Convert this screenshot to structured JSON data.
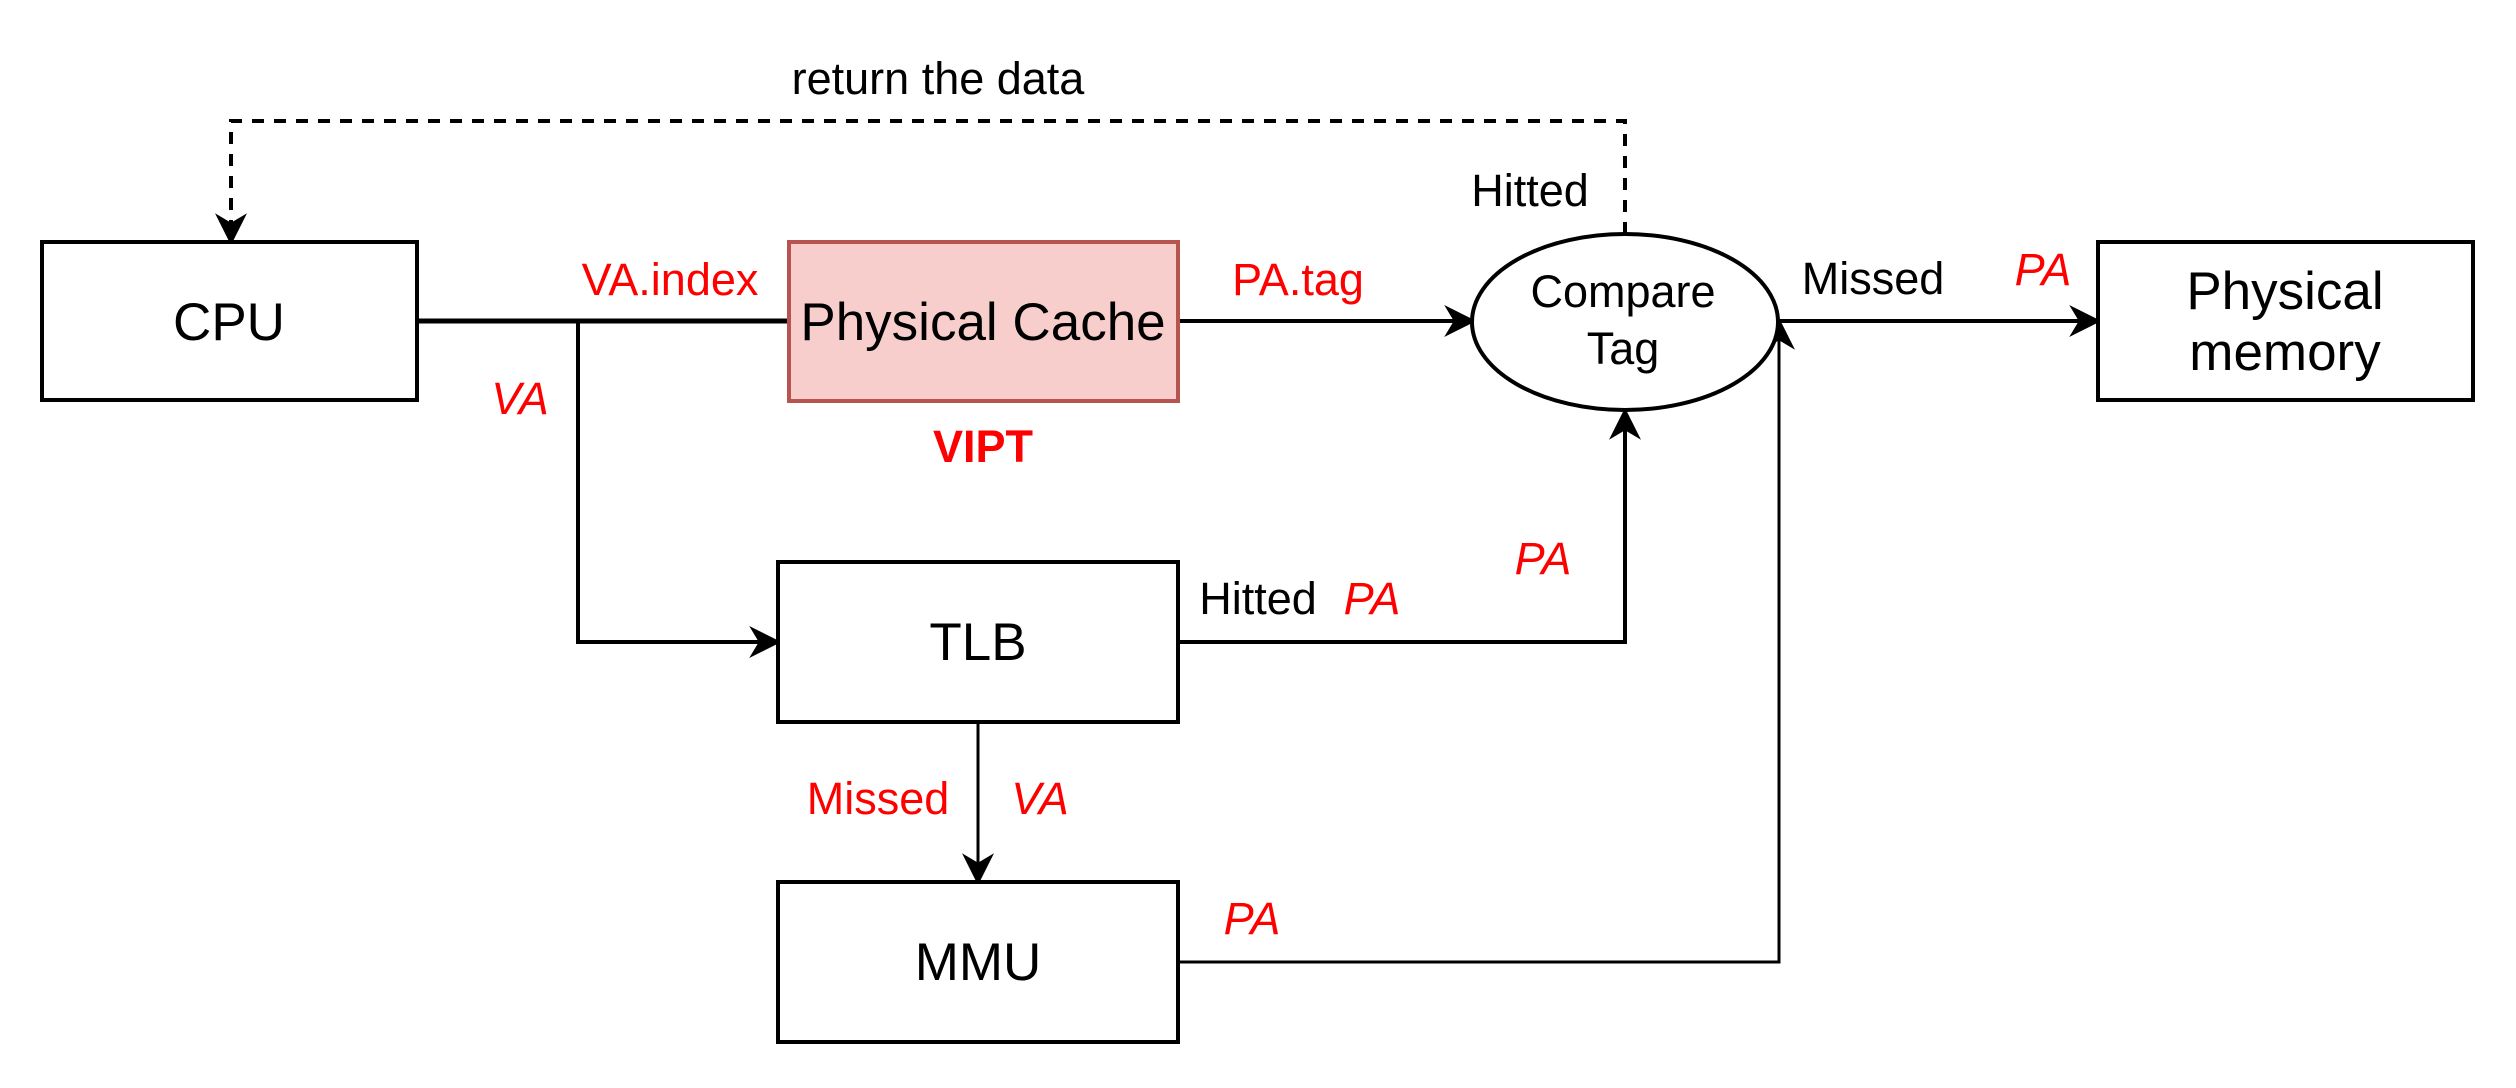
{
  "colors": {
    "stroke": "#000000",
    "cache_fill": "#f8cecc",
    "cache_stroke": "#b85450",
    "label_red": "#ff0000"
  },
  "nodes": {
    "cpu": {
      "label": "CPU"
    },
    "cache": {
      "label": "Physical Cache",
      "caption": "VIPT"
    },
    "compare": {
      "line1": "Compare",
      "line2": "Tag"
    },
    "memory": {
      "line1": "Physical",
      "line2": "memory"
    },
    "tlb": {
      "label": "TLB"
    },
    "mmu": {
      "label": "MMU"
    }
  },
  "edges": {
    "return_data": {
      "label": "return the data",
      "status": "Hitted"
    },
    "cpu_to_cache": {
      "label": "VA.index"
    },
    "cpu_to_tlb": {
      "label": "VA"
    },
    "cache_to_compare": {
      "label": "PA.tag"
    },
    "compare_to_memory": {
      "status": "Missed",
      "label": "PA"
    },
    "tlb_to_compare": {
      "status": "Hitted",
      "label": "PA",
      "label2": "PA"
    },
    "tlb_to_mmu": {
      "status": "Missed",
      "label": "VA"
    },
    "mmu_to_compare": {
      "label": "PA"
    }
  }
}
